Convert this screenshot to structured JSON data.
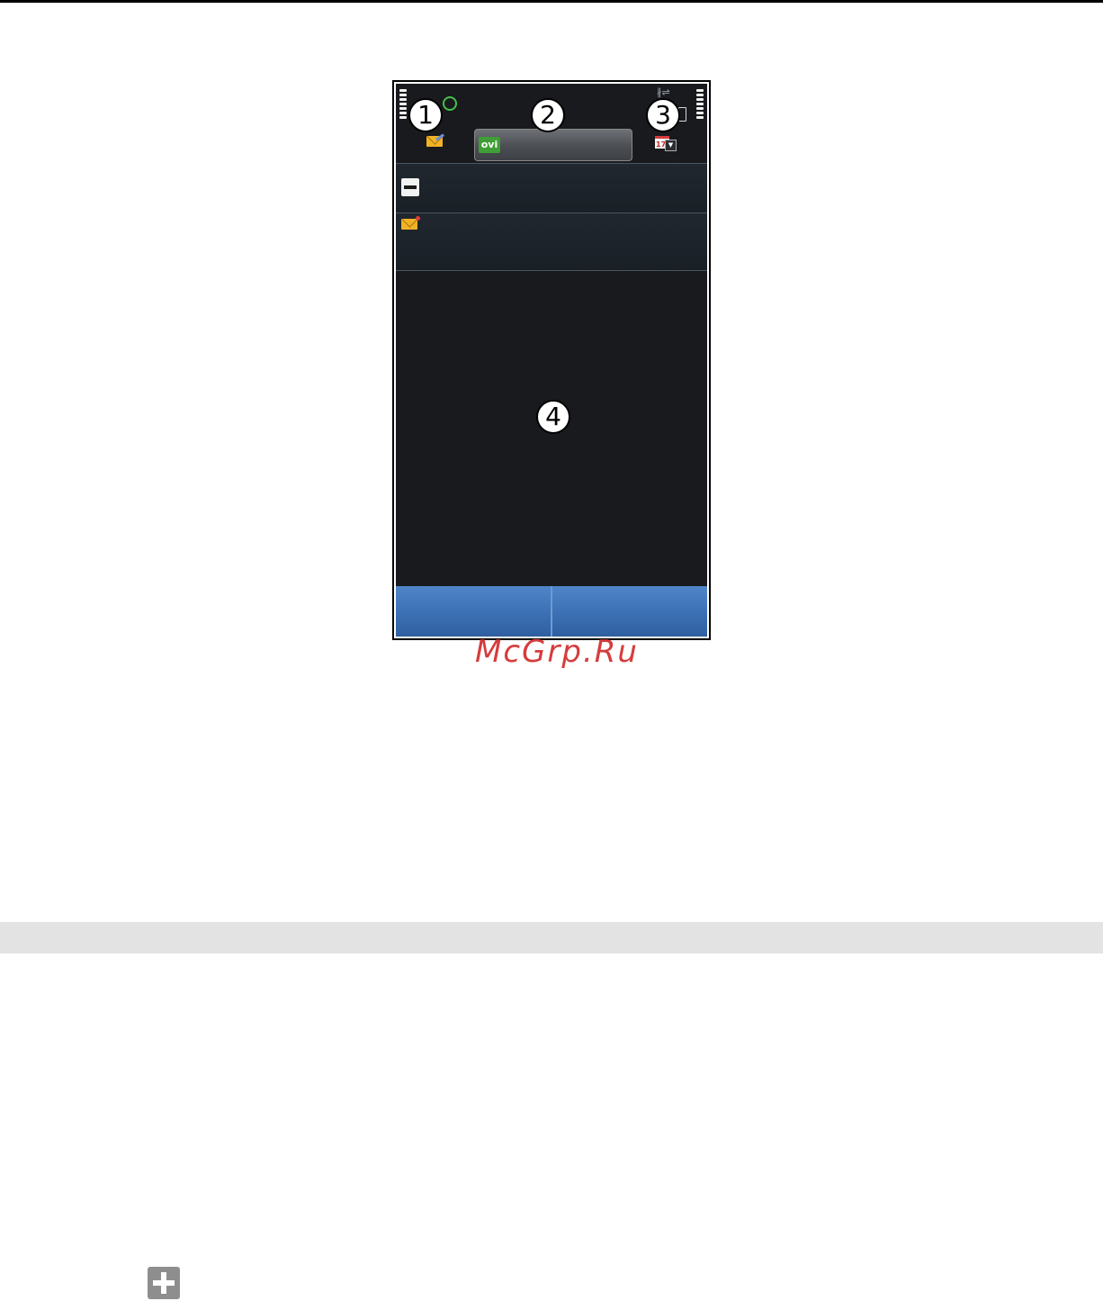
{
  "callouts": {
    "one": "1",
    "two": "2",
    "three": "3",
    "four": "4"
  },
  "status_bar": {
    "bluetooth_glyph": "∦⇌"
  },
  "ovi_search": {
    "logo_text": "ovi"
  },
  "calendar_widget": {
    "date_text": "17",
    "dropdown_glyph": "▼"
  },
  "watermark": "McGrp.Ru",
  "icons": {
    "status_left": "signal-bars-icon",
    "status_right": "battery-bars-icon",
    "network": "network-ring-icon",
    "mail_widget": "mail-icon",
    "collapse": "collapse-icon",
    "new_message": "new-mail-icon",
    "calendar": "calendar-icon",
    "footer": "plus-icon"
  },
  "colors": {
    "screen_background": "#181a1d",
    "softkey_blue": "#3c70b4",
    "ovi_green": "#3f9e35",
    "mail_yellow": "#f1b325",
    "watermark_red": "#d63c3c",
    "section_band": "#e3e3e3"
  }
}
